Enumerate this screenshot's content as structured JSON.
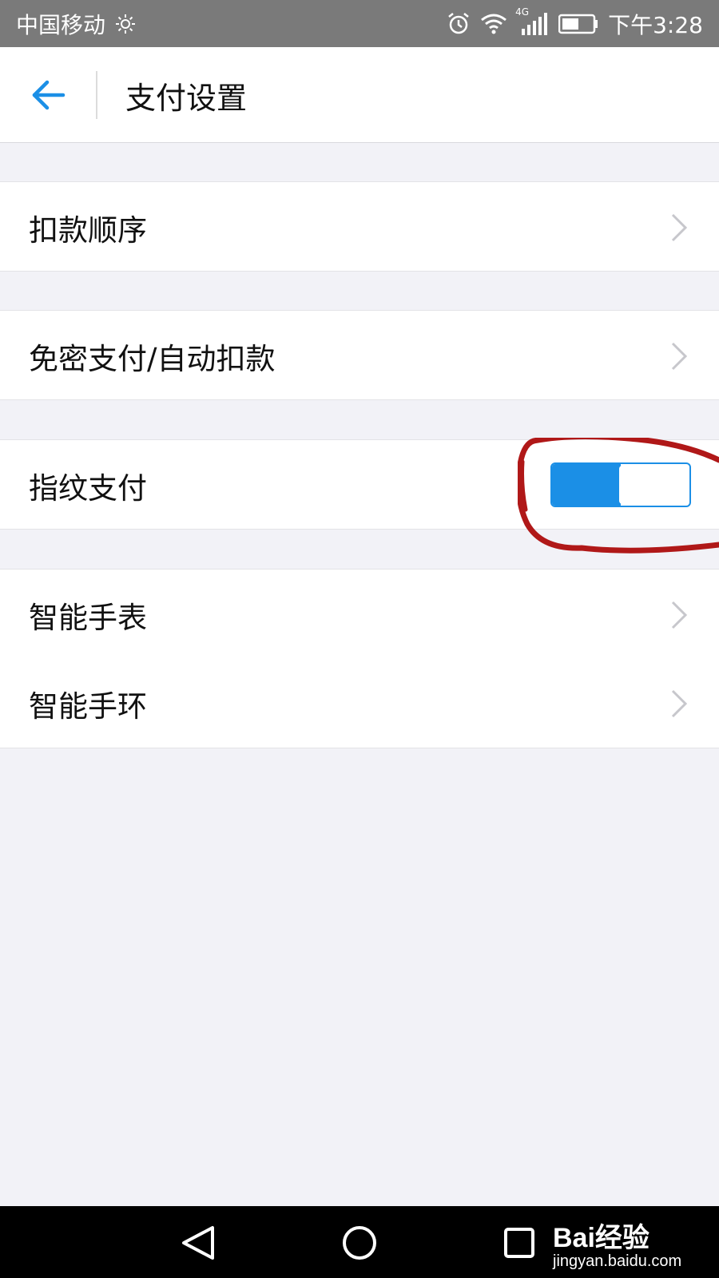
{
  "status_bar": {
    "carrier": "中国移动",
    "network": "4G",
    "time": "下午3:28",
    "icons": [
      "sun-icon",
      "alarm-icon",
      "wifi-icon",
      "signal-icon",
      "battery-icon"
    ]
  },
  "header": {
    "title": "支付设置",
    "back_icon": "back-arrow-icon"
  },
  "settings": {
    "items": [
      {
        "label": "扣款顺序",
        "control": "chevron"
      },
      {
        "label": "免密支付/自动扣款",
        "control": "chevron"
      },
      {
        "label": "指纹支付",
        "control": "toggle",
        "enabled": true
      },
      {
        "label": "智能手表",
        "control": "chevron"
      },
      {
        "label": "智能手环",
        "control": "chevron"
      }
    ]
  },
  "navigation": {
    "buttons": [
      "back-triangle-icon",
      "home-circle-icon",
      "recents-square-icon"
    ]
  },
  "watermark": {
    "brand": "Bai经验",
    "site": "jingyan.baidu.com"
  },
  "colors": {
    "accent": "#1b8fe6",
    "annotation": "#b01818",
    "background": "#f2f2f7",
    "status_bar": "#7a7a7a"
  }
}
